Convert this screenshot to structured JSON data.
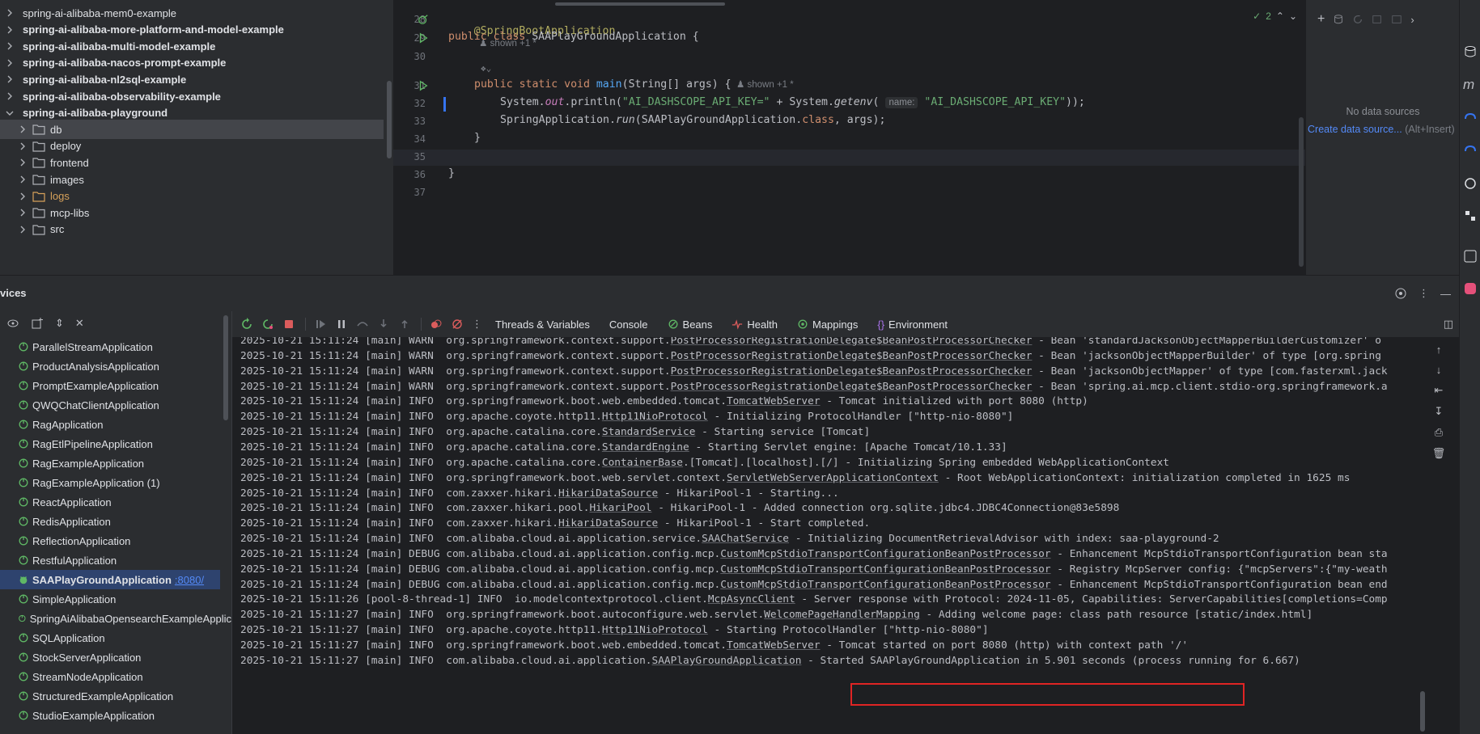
{
  "project_tree": {
    "items": [
      {
        "label": "spring-ai-alibaba-mem0-example",
        "bold": false,
        "indent": 0,
        "expanded": false
      },
      {
        "label": "spring-ai-alibaba-more-platform-and-model-example",
        "bold": true,
        "indent": 0,
        "expanded": false
      },
      {
        "label": "spring-ai-alibaba-multi-model-example",
        "bold": true,
        "indent": 0,
        "expanded": false
      },
      {
        "label": "spring-ai-alibaba-nacos-prompt-example",
        "bold": true,
        "indent": 0,
        "expanded": false
      },
      {
        "label": "spring-ai-alibaba-nl2sql-example",
        "bold": true,
        "indent": 0,
        "expanded": false
      },
      {
        "label": "spring-ai-alibaba-observability-example",
        "bold": true,
        "indent": 0,
        "expanded": false
      },
      {
        "label": "spring-ai-alibaba-playground",
        "bold": true,
        "indent": 0,
        "expanded": true
      },
      {
        "label": "db",
        "bold": false,
        "indent": 1,
        "expanded": false,
        "selected": true
      },
      {
        "label": "deploy",
        "bold": false,
        "indent": 1,
        "expanded": false
      },
      {
        "label": "frontend",
        "bold": false,
        "indent": 1,
        "expanded": false
      },
      {
        "label": "images",
        "bold": false,
        "indent": 1,
        "expanded": false
      },
      {
        "label": "logs",
        "bold": false,
        "indent": 1,
        "expanded": false,
        "excluded": true
      },
      {
        "label": "mcp-libs",
        "bold": false,
        "indent": 1,
        "expanded": false
      },
      {
        "label": "src",
        "bold": false,
        "indent": 1,
        "expanded": false
      }
    ]
  },
  "editor": {
    "line_numbers": [
      "28",
      "29",
      "30",
      "",
      "31",
      "32",
      "33",
      "34",
      "35",
      "36",
      "37"
    ],
    "inspection_count": "2",
    "hints": {
      "usages_28": "shown +1 *",
      "usages_31": "shown +1 *",
      "param_name": "name:"
    },
    "code": {
      "l28_annotation": "@SpringBootApplication",
      "l29_kw": "public class ",
      "l29_name": "SAAPlayGroundApplication {",
      "l31_kw1": "public static void ",
      "l31_fn": "main",
      "l31_rest": "(String[] args) {",
      "l32_a": "System.",
      "l32_out": "out",
      "l32_b": ".println(",
      "l32_str1": "\"AI_DASHSCOPE_API_KEY=\"",
      "l32_c": " + System.",
      "l32_getenv": "getenv",
      "l32_d": "(",
      "l32_str2": "\"AI_DASHSCOPE_API_KEY\"",
      "l32_e": "));",
      "l33_a": "SpringApplication.",
      "l33_run": "run",
      "l33_b": "(SAAPlayGroundApplication.",
      "l33_kw": "class",
      "l33_c": ", args);",
      "l34": "}",
      "l36": "}"
    }
  },
  "database": {
    "empty_text": "No data sources",
    "create_link": "Create data source...",
    "create_shortcut": " (Alt+Insert)"
  },
  "services": {
    "title": "vices",
    "items": [
      "ParallelStreamApplication",
      "ProductAnalysisApplication",
      "PromptExampleApplication",
      "QWQChatClientApplication",
      "RagApplication",
      "RagEtlPipelineApplication",
      "RagExampleApplication",
      "RagExampleApplication (1)",
      "ReactApplication",
      "RedisApplication",
      "ReflectionApplication",
      "RestfulApplication",
      "SAAPlayGroundApplication",
      "SimpleApplication",
      "SpringAiAlibabaOpensearchExampleApplic",
      "SQLApplication",
      "StockServerApplication",
      "StreamNodeApplication",
      "StructuredExampleApplication",
      "StudioExampleApplication"
    ],
    "selected_port": ":8080/"
  },
  "console": {
    "tabs": [
      "Threads & Variables",
      "Console",
      "Beans",
      "Health",
      "Mappings",
      "Environment"
    ],
    "lines": [
      {
        "ts": "2025-10-21 15:11:24",
        "thread": "[main]",
        "level": "WARN ",
        "pkg": "org.springframework.context.support.",
        "cls": "PostProcessorRegistrationDelegate$BeanPostProcessorChecker",
        "msg": " - Bean 'standardJacksonObjectMapperBuilderCustomizer' o"
      },
      {
        "ts": "2025-10-21 15:11:24",
        "thread": "[main]",
        "level": "WARN ",
        "pkg": "org.springframework.context.support.",
        "cls": "PostProcessorRegistrationDelegate$BeanPostProcessorChecker",
        "msg": " - Bean 'jacksonObjectMapperBuilder' of type [org.spring"
      },
      {
        "ts": "2025-10-21 15:11:24",
        "thread": "[main]",
        "level": "WARN ",
        "pkg": "org.springframework.context.support.",
        "cls": "PostProcessorRegistrationDelegate$BeanPostProcessorChecker",
        "msg": " - Bean 'jacksonObjectMapper' of type [com.fasterxml.jack"
      },
      {
        "ts": "2025-10-21 15:11:24",
        "thread": "[main]",
        "level": "WARN ",
        "pkg": "org.springframework.context.support.",
        "cls": "PostProcessorRegistrationDelegate$BeanPostProcessorChecker",
        "msg": " - Bean 'spring.ai.mcp.client.stdio-org.springframework.a"
      },
      {
        "ts": "2025-10-21 15:11:24",
        "thread": "[main]",
        "level": "INFO ",
        "pkg": "org.springframework.boot.web.embedded.tomcat.",
        "cls": "TomcatWebServer",
        "msg": " - Tomcat initialized with port 8080 (http)"
      },
      {
        "ts": "2025-10-21 15:11:24",
        "thread": "[main]",
        "level": "INFO ",
        "pkg": "org.apache.coyote.http11.",
        "cls": "Http11NioProtocol",
        "msg": " - Initializing ProtocolHandler [\"http-nio-8080\"]"
      },
      {
        "ts": "2025-10-21 15:11:24",
        "thread": "[main]",
        "level": "INFO ",
        "pkg": "org.apache.catalina.core.",
        "cls": "StandardService",
        "msg": " - Starting service [Tomcat]"
      },
      {
        "ts": "2025-10-21 15:11:24",
        "thread": "[main]",
        "level": "INFO ",
        "pkg": "org.apache.catalina.core.",
        "cls": "StandardEngine",
        "msg": " - Starting Servlet engine: [Apache Tomcat/10.1.33]"
      },
      {
        "ts": "2025-10-21 15:11:24",
        "thread": "[main]",
        "level": "INFO ",
        "pkg": "org.apache.catalina.core.",
        "cls": "ContainerBase",
        "msg": ".[Tomcat].[localhost].[/] - Initializing Spring embedded WebApplicationContext"
      },
      {
        "ts": "2025-10-21 15:11:24",
        "thread": "[main]",
        "level": "INFO ",
        "pkg": "org.springframework.boot.web.servlet.context.",
        "cls": "ServletWebServerApplicationContext",
        "msg": " - Root WebApplicationContext: initialization completed in 1625 ms"
      },
      {
        "ts": "2025-10-21 15:11:24",
        "thread": "[main]",
        "level": "INFO ",
        "pkg": "com.zaxxer.hikari.",
        "cls": "HikariDataSource",
        "msg": " - HikariPool-1 - Starting..."
      },
      {
        "ts": "2025-10-21 15:11:24",
        "thread": "[main]",
        "level": "INFO ",
        "pkg": "com.zaxxer.hikari.pool.",
        "cls": "HikariPool",
        "msg": " - HikariPool-1 - Added connection org.sqlite.jdbc4.JDBC4Connection@83e5898"
      },
      {
        "ts": "2025-10-21 15:11:24",
        "thread": "[main]",
        "level": "INFO ",
        "pkg": "com.zaxxer.hikari.",
        "cls": "HikariDataSource",
        "msg": " - HikariPool-1 - Start completed."
      },
      {
        "ts": "2025-10-21 15:11:24",
        "thread": "[main]",
        "level": "INFO ",
        "pkg": "com.alibaba.cloud.ai.application.service.",
        "cls": "SAAChatService",
        "msg": " - Initializing DocumentRetrievalAdvisor with index: saa-playground-2"
      },
      {
        "ts": "2025-10-21 15:11:24",
        "thread": "[main]",
        "level": "DEBUG",
        "pkg": "com.alibaba.cloud.ai.application.config.mcp.",
        "cls": "CustomMcpStdioTransportConfigurationBeanPostProcessor",
        "msg": " - Enhancement McpStdioTransportConfiguration bean sta"
      },
      {
        "ts": "2025-10-21 15:11:24",
        "thread": "[main]",
        "level": "DEBUG",
        "pkg": "com.alibaba.cloud.ai.application.config.mcp.",
        "cls": "CustomMcpStdioTransportConfigurationBeanPostProcessor",
        "msg": " - Registry McpServer config: {\"mcpServers\":{\"my-weath"
      },
      {
        "ts": "2025-10-21 15:11:24",
        "thread": "[main]",
        "level": "DEBUG",
        "pkg": "com.alibaba.cloud.ai.application.config.mcp.",
        "cls": "CustomMcpStdioTransportConfigurationBeanPostProcessor",
        "msg": " - Enhancement McpStdioTransportConfiguration bean end"
      },
      {
        "ts": "2025-10-21 15:11:26",
        "thread": "[pool-8-thread-1]",
        "level": "INFO ",
        "pkg": "io.modelcontextprotocol.client.",
        "cls": "McpAsyncClient",
        "msg": " - Server response with Protocol: 2024-11-05, Capabilities: ServerCapabilities[completions=Comp"
      },
      {
        "ts": "2025-10-21 15:11:27",
        "thread": "[main]",
        "level": "INFO ",
        "pkg": "org.springframework.boot.autoconfigure.web.servlet.",
        "cls": "WelcomePageHandlerMapping",
        "msg": " - Adding welcome page: class path resource [static/index.html]"
      },
      {
        "ts": "2025-10-21 15:11:27",
        "thread": "[main]",
        "level": "INFO ",
        "pkg": "org.apache.coyote.http11.",
        "cls": "Http11NioProtocol",
        "msg": " - Starting ProtocolHandler [\"http-nio-8080\"]"
      },
      {
        "ts": "2025-10-21 15:11:27",
        "thread": "[main]",
        "level": "INFO ",
        "pkg": "org.springframework.boot.web.embedded.tomcat.",
        "cls": "TomcatWebServer",
        "msg": " - Tomcat started on port 8080 (http) with context path '/'"
      },
      {
        "ts": "2025-10-21 15:11:27",
        "thread": "[main]",
        "level": "INFO ",
        "pkg": "com.alibaba.cloud.ai.application.",
        "cls": "SAAPlayGroundApplication",
        "msg": " - Started SAAPlayGroundApplication in 5.901 seconds (process running for 6.667)"
      }
    ]
  },
  "colors": {
    "accent": "#3574f0",
    "highlight_box": "#e02424",
    "run_green": "#5fb865"
  }
}
